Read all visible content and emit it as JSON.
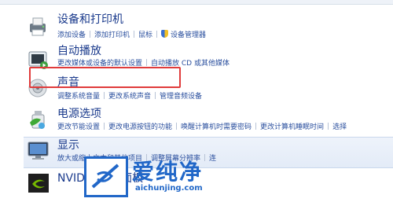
{
  "categories": [
    {
      "title": "设备和打印机",
      "icon": "printer-icon",
      "links": [
        "添加设备",
        "添加打印机",
        "鼠标",
        "设备管理器"
      ]
    },
    {
      "title": "自动播放",
      "icon": "autoplay-icon",
      "links": [
        "更改媒体或设备的默认设置",
        "自动播放 CD 或其他媒体"
      ]
    },
    {
      "title": "声音",
      "icon": "speaker-icon",
      "links": [
        "调整系统音量",
        "更改系统声音",
        "管理音频设备"
      ]
    },
    {
      "title": "电源选项",
      "icon": "power-icon",
      "links": [
        "更改节能设置",
        "更改电源按钮的功能",
        "唤醒计算机时需要密码",
        "更改计算机睡眠时间",
        "选择"
      ]
    },
    {
      "title": "显示",
      "icon": "display-icon",
      "links": [
        "放大或缩小文本和其他项目",
        "调整屏幕分辨率",
        "连"
      ]
    },
    {
      "title": "NVIDIA 控制面板",
      "icon": "nvidia-icon",
      "links": []
    }
  ],
  "watermark": {
    "brand": "爱纯净",
    "url": "aichunjing.com"
  },
  "colors": {
    "highlight": "#e03b3b",
    "link": "#2a4f9e",
    "title": "#1a3a8c",
    "brand": "#2167c8"
  }
}
